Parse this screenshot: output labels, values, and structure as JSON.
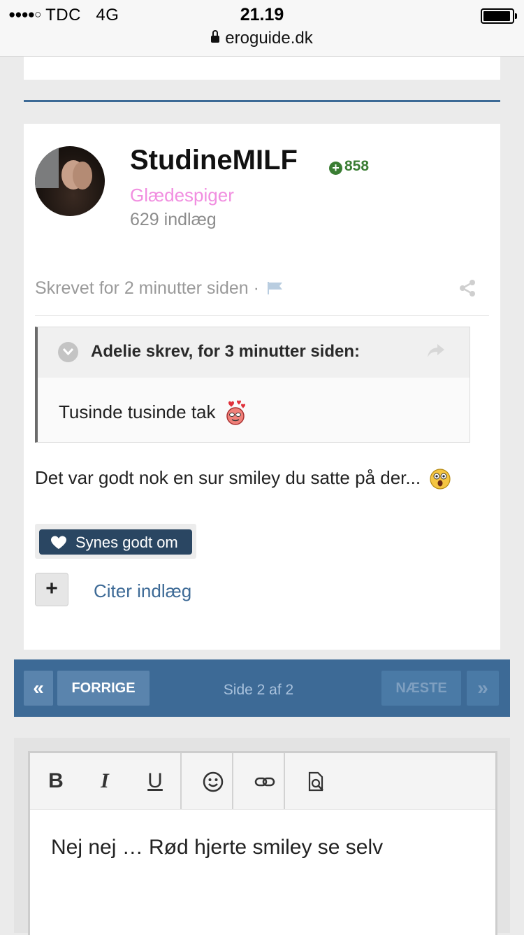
{
  "status_bar": {
    "signal": "●●●●○",
    "carrier": "TDC",
    "network": "4G",
    "time": "21.19",
    "url": "eroguide.dk"
  },
  "post": {
    "username": "StudineMILF",
    "reputation": "858",
    "group": "Glædespiger",
    "post_count": "629 indlæg",
    "meta": "Skrevet for 2 minutter siden ·",
    "quote": {
      "title": "Adelie skrev, for 3 minutter siden:",
      "body": "Tusinde tusinde tak"
    },
    "body": "Det var godt nok en sur smiley du satte på der...",
    "like_label": "Synes godt om",
    "multiquote_label": "+",
    "cite_label": "Citer indlæg"
  },
  "pagination": {
    "first": "«",
    "prev": "FORRIGE",
    "page_label": "Side 2 af 2",
    "next": "NÆSTE",
    "last": "»"
  },
  "editor": {
    "toolbar": {
      "bold": "B",
      "italic": "I",
      "underline": "U"
    },
    "content": "Nej nej … Rød hjerte smiley se selv"
  },
  "colors": {
    "accent": "#3d6a96",
    "group": "#f18ee0",
    "reputation": "#3a7d33",
    "like_button": "#2a4662"
  }
}
